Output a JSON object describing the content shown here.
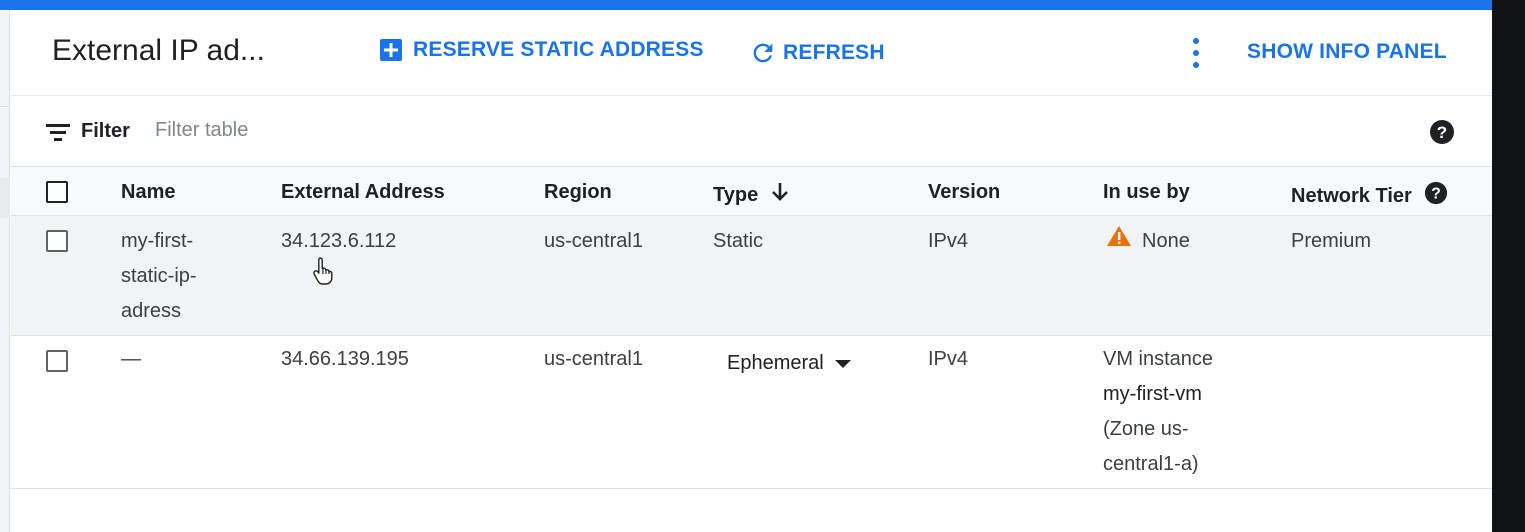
{
  "header": {
    "title": "External IP ad...",
    "reserve_label": "RESERVE STATIC ADDRESS",
    "refresh_label": "REFRESH",
    "info_panel_label": "SHOW INFO PANEL"
  },
  "filter": {
    "label": "Filter",
    "placeholder": "Filter table"
  },
  "table": {
    "columns": [
      "Name",
      "External Address",
      "Region",
      "Type",
      "Version",
      "In use by",
      "Network Tier"
    ],
    "rows": [
      {
        "name_lines": [
          "my-first-",
          "static-ip-",
          "adress"
        ],
        "address": "34.123.6.112",
        "region": "us-central1",
        "type": "Static",
        "version": "IPv4",
        "in_use_by": "None",
        "network_tier": "Premium"
      },
      {
        "name": "—",
        "address": "34.66.139.195",
        "region": "us-central1",
        "type": "Ephemeral",
        "version": "IPv4",
        "in_use_lines": [
          "VM instance",
          "my-first-vm",
          "(Zone us-",
          "central1-a)"
        ],
        "network_tier": ""
      }
    ]
  },
  "colors": {
    "accent": "#1a73e8",
    "warning": "#e8710a",
    "selected_row": "#f1f3f4",
    "header_row": "#f8f9fa"
  },
  "icons": {
    "reserve": "add-box-icon",
    "refresh": "refresh-icon",
    "more": "more-vert-icon",
    "filter": "filter-list-icon",
    "help": "help-icon",
    "sort": "arrow-downward-icon",
    "warning": "warning-icon",
    "dropdown": "arrow-drop-down-icon",
    "cursor": "hand-pointer-cursor"
  }
}
